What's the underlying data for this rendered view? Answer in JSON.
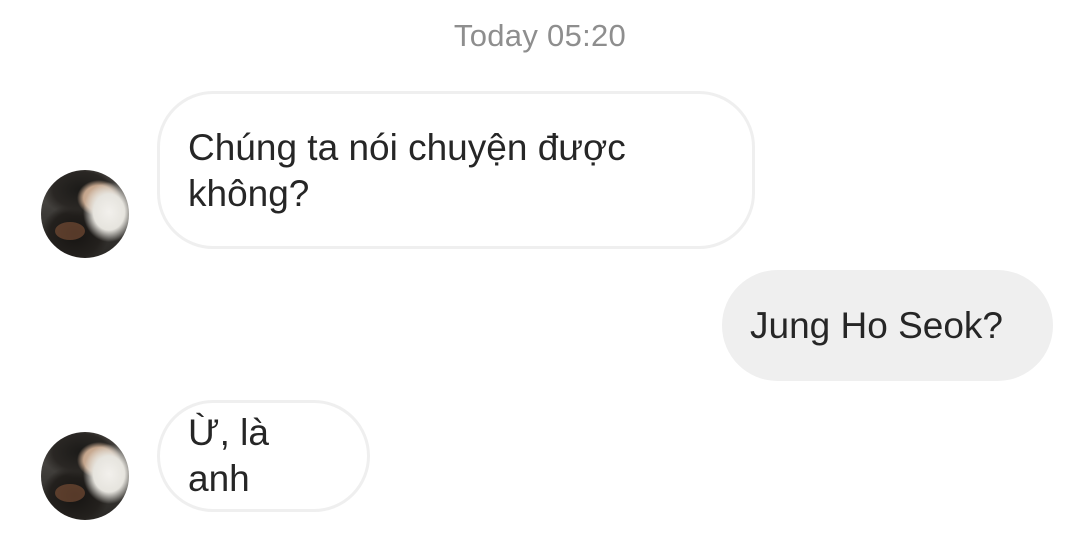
{
  "thread": {
    "timestamp": "Today 05:20",
    "messages": [
      {
        "sender": "other",
        "text": "Chúng ta nói chuyện được không?"
      },
      {
        "sender": "self",
        "text": "Jung Ho Seok?"
      },
      {
        "sender": "other",
        "text": "Ừ, là anh"
      }
    ]
  },
  "colors": {
    "background": "#ffffff",
    "incoming_bubble_border": "#efefef",
    "outgoing_bubble_fill": "#efefef",
    "timestamp_text": "#8e8e8e",
    "message_text": "#262626"
  }
}
